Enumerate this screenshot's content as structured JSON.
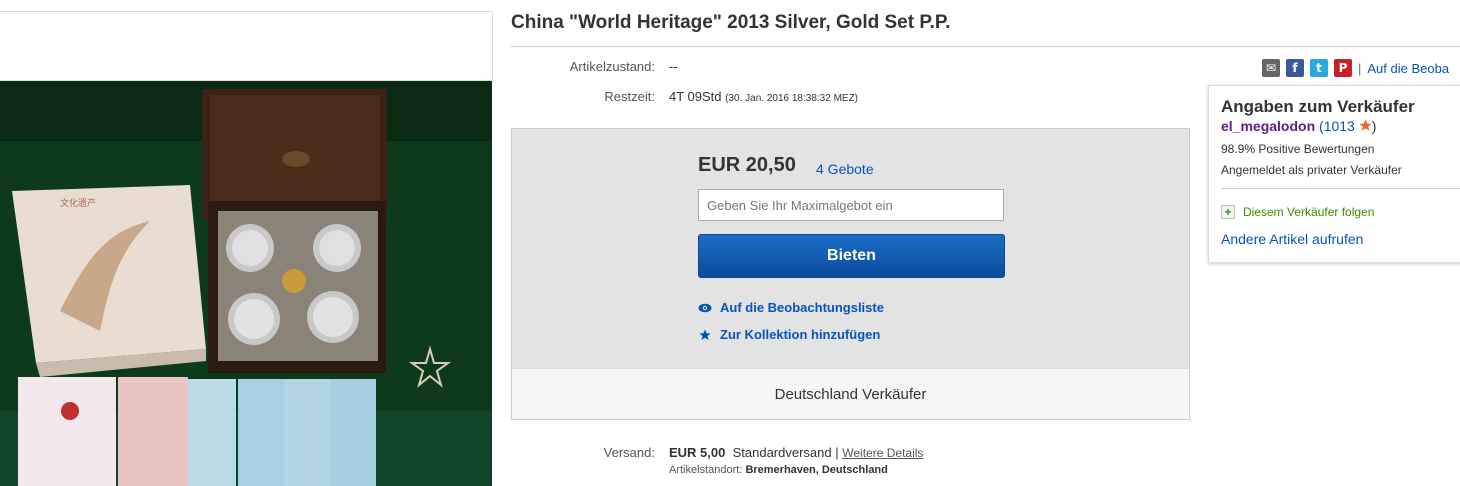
{
  "title": "China \"World Heritage\" 2013 Silver, Gold Set P.P.",
  "condition": {
    "label": "Artikelzustand:",
    "value": "--"
  },
  "time_left": {
    "label": "Restzeit:",
    "value": "4T 09Std",
    "end": "(30. Jan. 2016   18:38:32 MEZ)"
  },
  "share": {
    "icons": [
      "mail-icon",
      "facebook-icon",
      "twitter-icon",
      "pinterest-icon"
    ],
    "separator": "|",
    "watch_label": "Auf die Beoba"
  },
  "bid": {
    "price": "EUR 20,50",
    "bids": "4 Gebote",
    "max_bid_placeholder": "Geben Sie Ihr Maximalgebot ein",
    "button_label": "Bieten",
    "watchlist_label": "Auf die Beobachtungsliste",
    "collection_label": "Zur Kollektion hinzufügen",
    "footer": "Deutschland Verkäufer"
  },
  "seller": {
    "heading": "Angaben zum Verkäufer",
    "username": "el_megalodon",
    "score_open": "(",
    "score": "1013",
    "score_close": ")",
    "star_color": "#e8692d",
    "feedback": "98.9% Positive Bewertungen",
    "type": "Angemeldet als privater Verkäufer",
    "follow": "Diesem Verkäufer folgen",
    "other_items": "Andere Artikel aufrufen"
  },
  "shipping": {
    "label": "Versand:",
    "cost": "EUR 5,00",
    "method": "Standardversand",
    "separator": "|",
    "details_link": "Weitere Details",
    "location_label": "Artikelstandort:",
    "location": "Bremerhaven, Deutschland"
  },
  "colors": {
    "link": "#0654ba",
    "bid_button": "#0a4d9c",
    "username": "#5d1d91",
    "follow": "#3a8e00"
  }
}
